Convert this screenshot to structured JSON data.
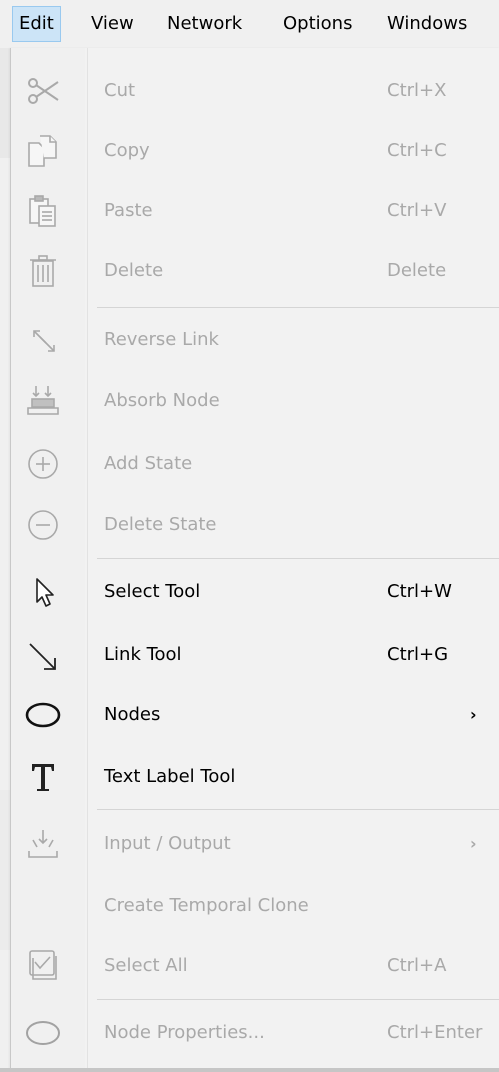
{
  "menubar": {
    "items": [
      {
        "label": "Edit",
        "active": true
      },
      {
        "label": "View"
      },
      {
        "label": "Network"
      },
      {
        "label": "Options"
      },
      {
        "label": "Windows"
      }
    ]
  },
  "edit_menu": {
    "items": [
      {
        "label": "Cut",
        "shortcut": "Ctrl+X",
        "icon": "scissors-icon",
        "enabled": false
      },
      {
        "label": "Copy",
        "shortcut": "Ctrl+C",
        "icon": "copy-icon",
        "enabled": false
      },
      {
        "label": "Paste",
        "shortcut": "Ctrl+V",
        "icon": "paste-icon",
        "enabled": false
      },
      {
        "label": "Delete",
        "shortcut": "Delete",
        "icon": "trash-icon",
        "enabled": false
      },
      {
        "label": "Reverse Link",
        "shortcut": "",
        "icon": "reverse-link-icon",
        "enabled": false
      },
      {
        "label": "Absorb Node",
        "shortcut": "",
        "icon": "absorb-node-icon",
        "enabled": false
      },
      {
        "label": "Add State",
        "shortcut": "",
        "icon": "plus-circle-icon",
        "enabled": false
      },
      {
        "label": "Delete State",
        "shortcut": "",
        "icon": "minus-circle-icon",
        "enabled": false
      },
      {
        "label": "Select Tool",
        "shortcut": "Ctrl+W",
        "icon": "cursor-arrow-icon",
        "enabled": true
      },
      {
        "label": "Link Tool",
        "shortcut": "Ctrl+G",
        "icon": "link-arrow-icon",
        "enabled": true
      },
      {
        "label": "Nodes",
        "shortcut": "",
        "icon": "ellipse-node-icon",
        "enabled": true,
        "submenu": true
      },
      {
        "label": "Text Label Tool",
        "shortcut": "",
        "icon": "text-t-icon",
        "enabled": true
      },
      {
        "label": "Input / Output",
        "shortcut": "",
        "icon": "input-output-icon",
        "enabled": false,
        "submenu": true
      },
      {
        "label": "Create Temporal Clone",
        "shortcut": "",
        "icon": "",
        "enabled": false
      },
      {
        "label": "Select All",
        "shortcut": "Ctrl+A",
        "icon": "select-all-checkbox-icon",
        "enabled": false
      },
      {
        "label": "Node Properties...",
        "shortcut": "Ctrl+Enter",
        "icon": "node-properties-ellipse-icon",
        "enabled": false
      }
    ],
    "submenu_arrow": "›"
  },
  "colors": {
    "menu_background": "#f2f2f2",
    "active_menubar_background": "#cce4f7",
    "active_menubar_border": "#99c9ef",
    "disabled_text": "#a9a9a9",
    "enabled_text": "#000000",
    "separator": "#d5d5d5"
  }
}
